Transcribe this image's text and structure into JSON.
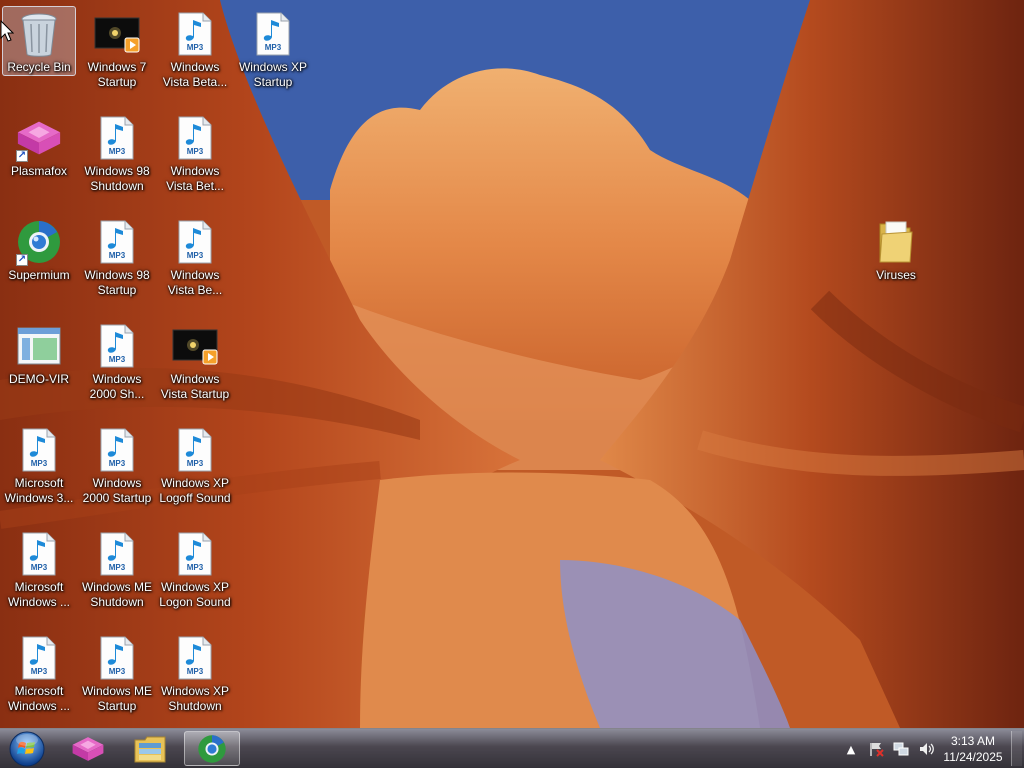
{
  "desktop": {
    "icons": [
      {
        "id": "recycle-bin",
        "label": "Recycle Bin",
        "type": "recycle",
        "selected": true
      },
      {
        "id": "windows-7-startup",
        "label": "Windows 7\nStartup",
        "type": "video"
      },
      {
        "id": "windows-vista-beta-1",
        "label": "Windows\nVista Beta...",
        "type": "mp3"
      },
      {
        "id": "windows-xp-startup",
        "label": "Windows XP\nStartup",
        "type": "mp3"
      },
      {
        "id": "plasmafox",
        "label": "Plasmafox",
        "type": "plasmafox",
        "shortcut": true
      },
      {
        "id": "windows-98-shutdown",
        "label": "Windows 98\nShutdown",
        "type": "mp3"
      },
      {
        "id": "windows-vista-beta-2",
        "label": "Windows\nVista Bet...",
        "type": "mp3"
      },
      {
        "id": "supermium",
        "label": "Supermium",
        "type": "supermium",
        "shortcut": true
      },
      {
        "id": "windows-98-startup",
        "label": "Windows 98\nStartup",
        "type": "mp3"
      },
      {
        "id": "windows-vista-beta-3",
        "label": "Windows\nVista Be...",
        "type": "mp3"
      },
      {
        "id": "demo-vir",
        "label": "DEMO-VIR",
        "type": "app"
      },
      {
        "id": "windows-2000-shutdown",
        "label": "Windows\n2000 Sh...",
        "type": "mp3"
      },
      {
        "id": "windows-vista-startup",
        "label": "Windows\nVista Startup",
        "type": "video"
      },
      {
        "id": "microsoft-windows-3-1",
        "label": "Microsoft\nWindows 3...",
        "type": "mp3"
      },
      {
        "id": "windows-2000-startup",
        "label": "Windows\n2000 Startup",
        "type": "mp3"
      },
      {
        "id": "windows-xp-logoff-sound",
        "label": "Windows XP\nLogoff Sound",
        "type": "mp3"
      },
      {
        "id": "microsoft-windows-2",
        "label": "Microsoft\nWindows ...",
        "type": "mp3"
      },
      {
        "id": "windows-me-shutdown",
        "label": "Windows ME\nShutdown",
        "type": "mp3"
      },
      {
        "id": "windows-xp-logon-sound",
        "label": "Windows XP\nLogon Sound",
        "type": "mp3"
      },
      {
        "id": "microsoft-windows-3",
        "label": "Microsoft\nWindows ...",
        "type": "mp3"
      },
      {
        "id": "windows-me-startup",
        "label": "Windows ME\nStartup",
        "type": "mp3"
      },
      {
        "id": "windows-xp-shutdown",
        "label": "Windows XP\nShutdown",
        "type": "mp3"
      },
      {
        "id": "viruses",
        "label": "Viruses",
        "type": "folder"
      }
    ],
    "mp3_badge": "MP3"
  },
  "taskbar": {
    "start_icon": "windows-orb-icon",
    "pinned": [
      {
        "id": "plasmafox",
        "icon": "plasmafox-icon",
        "active": false
      },
      {
        "id": "file-explorer",
        "icon": "folder-library-icon",
        "active": false
      },
      {
        "id": "supermium",
        "icon": "supermium-icon",
        "active": true
      }
    ],
    "tray": {
      "icons": [
        "show-hidden-icons-chevron",
        "action-center-flag-icon",
        "network-icon",
        "volume-icon"
      ],
      "time": "3:13 AM",
      "date": "11/24/2025"
    }
  },
  "colors": {
    "taskbar_dark": "#2a2830",
    "sky": "#3c5fa8",
    "rock": "#c5642a"
  }
}
